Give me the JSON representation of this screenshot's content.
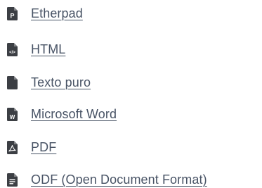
{
  "export_menu": {
    "items": [
      {
        "label": "Etherpad",
        "icon": "etherpad-file-icon",
        "badge": "P"
      },
      {
        "label": "HTML",
        "icon": "html-file-icon",
        "badge": "</>"
      },
      {
        "label": "Texto puro",
        "icon": "text-file-icon",
        "badge": ""
      },
      {
        "label": "Microsoft Word",
        "icon": "word-file-icon",
        "badge": "W"
      },
      {
        "label": "PDF",
        "icon": "pdf-file-icon",
        "badge": ""
      },
      {
        "label": "ODF (Open Document Format)",
        "icon": "odf-file-icon",
        "badge": ""
      }
    ]
  },
  "colors": {
    "icon": "#3c3f44",
    "link_text": "#485365",
    "background": "#ffffff"
  }
}
